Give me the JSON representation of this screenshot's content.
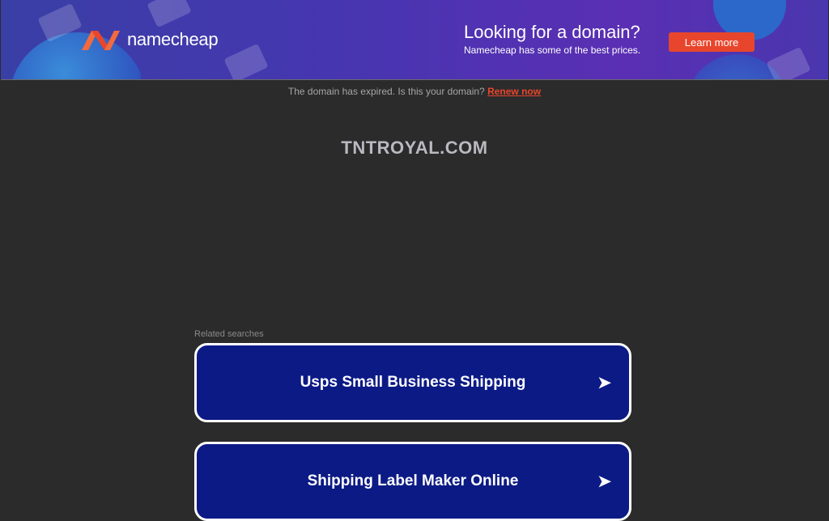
{
  "banner": {
    "logo_text": "namecheap",
    "promo_title": "Looking for a domain?",
    "promo_subtitle": "Namecheap has some of the best prices.",
    "learn_more_label": "Learn more",
    "colors": {
      "accent": "#e8462c",
      "banner_bg": "#4636b0"
    }
  },
  "notice": {
    "text": "The domain has expired. Is this your domain?",
    "renew_label": "Renew now"
  },
  "domain": {
    "title": "TNTROYAL.COM"
  },
  "related": {
    "label": "Related searches",
    "items": [
      {
        "label": "Usps Small Business Shipping",
        "icon": "arrow-right-icon"
      },
      {
        "label": "Shipping Label Maker Online",
        "icon": "arrow-right-icon"
      }
    ]
  }
}
